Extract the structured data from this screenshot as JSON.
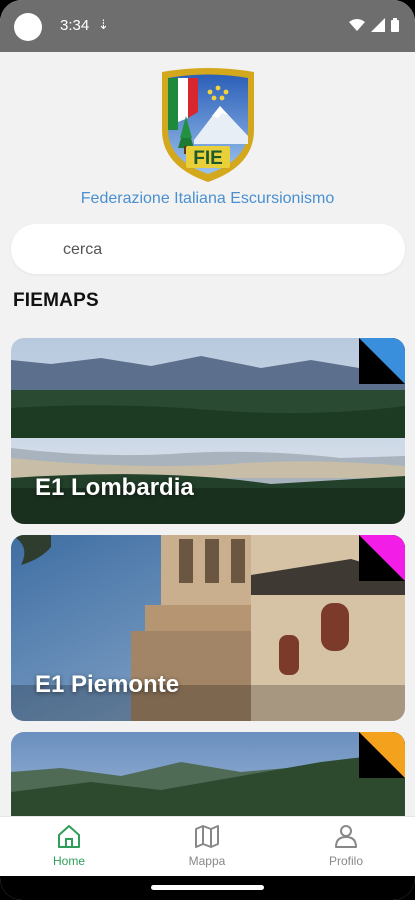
{
  "status_bar": {
    "time": "3:34",
    "download_icon": "download-arrow-icon"
  },
  "header": {
    "federation_name": "Federazione Italiana Escursionismo",
    "logo_text": "FIE"
  },
  "search": {
    "placeholder": "cerca",
    "value": ""
  },
  "section": {
    "title": "FIEMAPS"
  },
  "cards": [
    {
      "label": "E1 Lombardia",
      "corner_color": "#3a8fdc"
    },
    {
      "label": "E1 Piemonte",
      "corner_color": "#f21ee8"
    },
    {
      "label": "",
      "corner_color": "#f4a11d"
    }
  ],
  "bottom_nav": {
    "items": [
      {
        "label": "Home",
        "icon": "home-icon",
        "active": true
      },
      {
        "label": "Mappa",
        "icon": "map-icon",
        "active": false
      },
      {
        "label": "Profilo",
        "icon": "profile-icon",
        "active": false
      }
    ]
  },
  "colors": {
    "accent": "#2f9e5a",
    "federation_text": "#4a90d0"
  }
}
